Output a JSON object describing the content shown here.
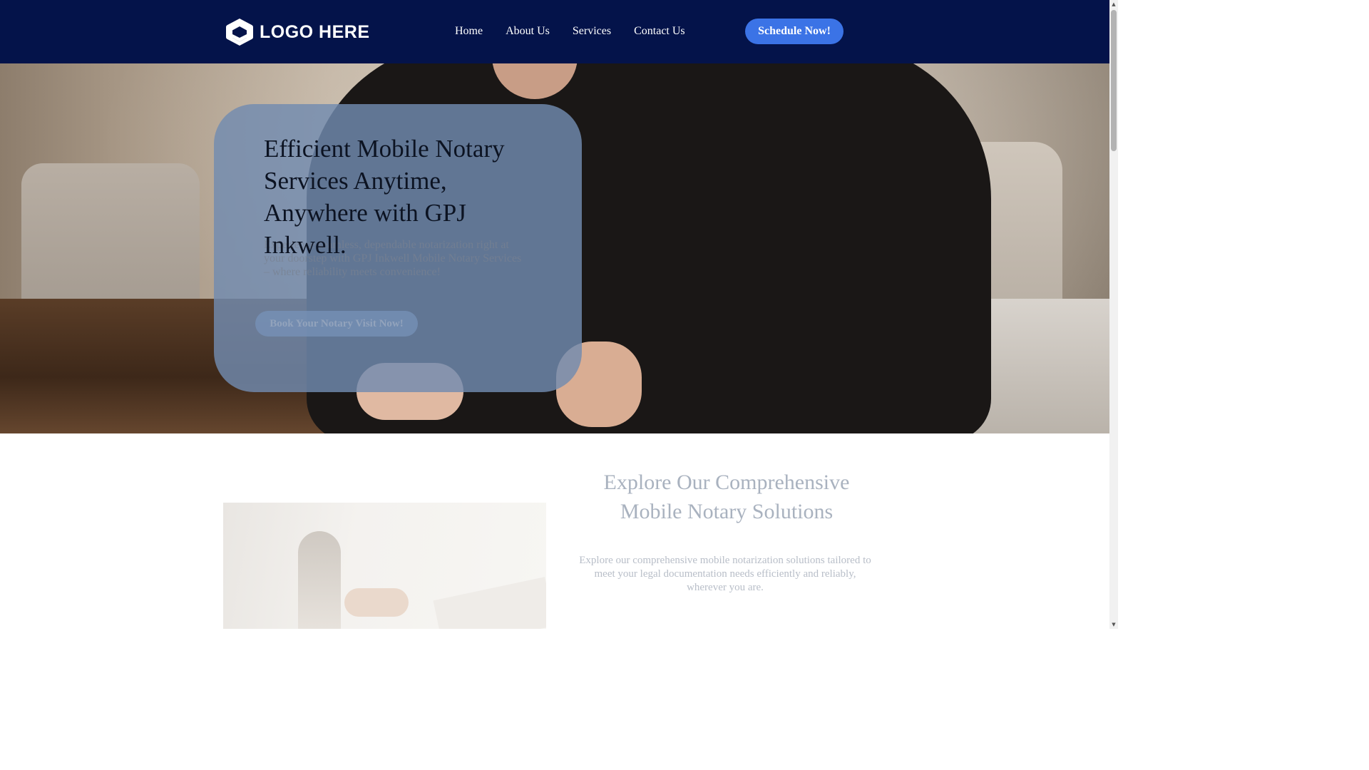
{
  "header": {
    "logo_text": "LOGO HERE",
    "nav": [
      "Home",
      "About Us",
      "Services",
      "Contact Us"
    ],
    "cta_label": "Schedule Now!"
  },
  "hero": {
    "title": "Efficient Mobile Notary Services Anytime, Anywhere with GPJ Inkwell.",
    "subtitle": "Experience seamless, dependable notarization right at your doorstep with GPJ Inkwell Mobile Notary Services – where reliability meets convenience!",
    "button_label": "Book Your Notary Visit Now!"
  },
  "section": {
    "title": "Explore Our Comprehensive Mobile Notary Solutions",
    "text": "Explore our comprehensive mobile notarization solutions tailored to meet your legal documentation needs efficiently and reliably, wherever you are."
  },
  "scrollbar": {
    "up_icon": "▲",
    "down_icon": "▼"
  },
  "colors": {
    "header_bg": "#04134a",
    "cta_bg": "#3b73e6",
    "hero_card": "#718bb0"
  }
}
